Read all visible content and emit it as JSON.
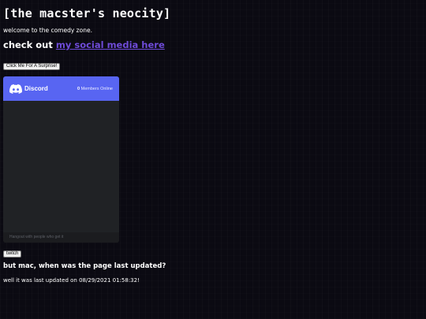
{
  "header": {
    "title": "[the macster's neocity]",
    "welcome": "welcome to the comedy zone."
  },
  "social": {
    "prefix": "check out ",
    "link_text": "my social media here",
    "link_color": "#6e4bd8"
  },
  "buttons": {
    "surprise_label": "Click Me For A Surprise!",
    "twitch_label": "twitch"
  },
  "discord": {
    "brand": "Discord",
    "logo_icon": "discord-logo-icon",
    "members_count": "0",
    "members_label": " Members Online",
    "footer_text": "Hangout with people who get it",
    "accent": "#5865f2"
  },
  "updated": {
    "heading": "but mac, when was the page last updated?",
    "text": "well it was last updated on 08/29/2021 01:58:32!"
  },
  "colors": {
    "background": "#0b0a12",
    "text": "#ffffff"
  }
}
